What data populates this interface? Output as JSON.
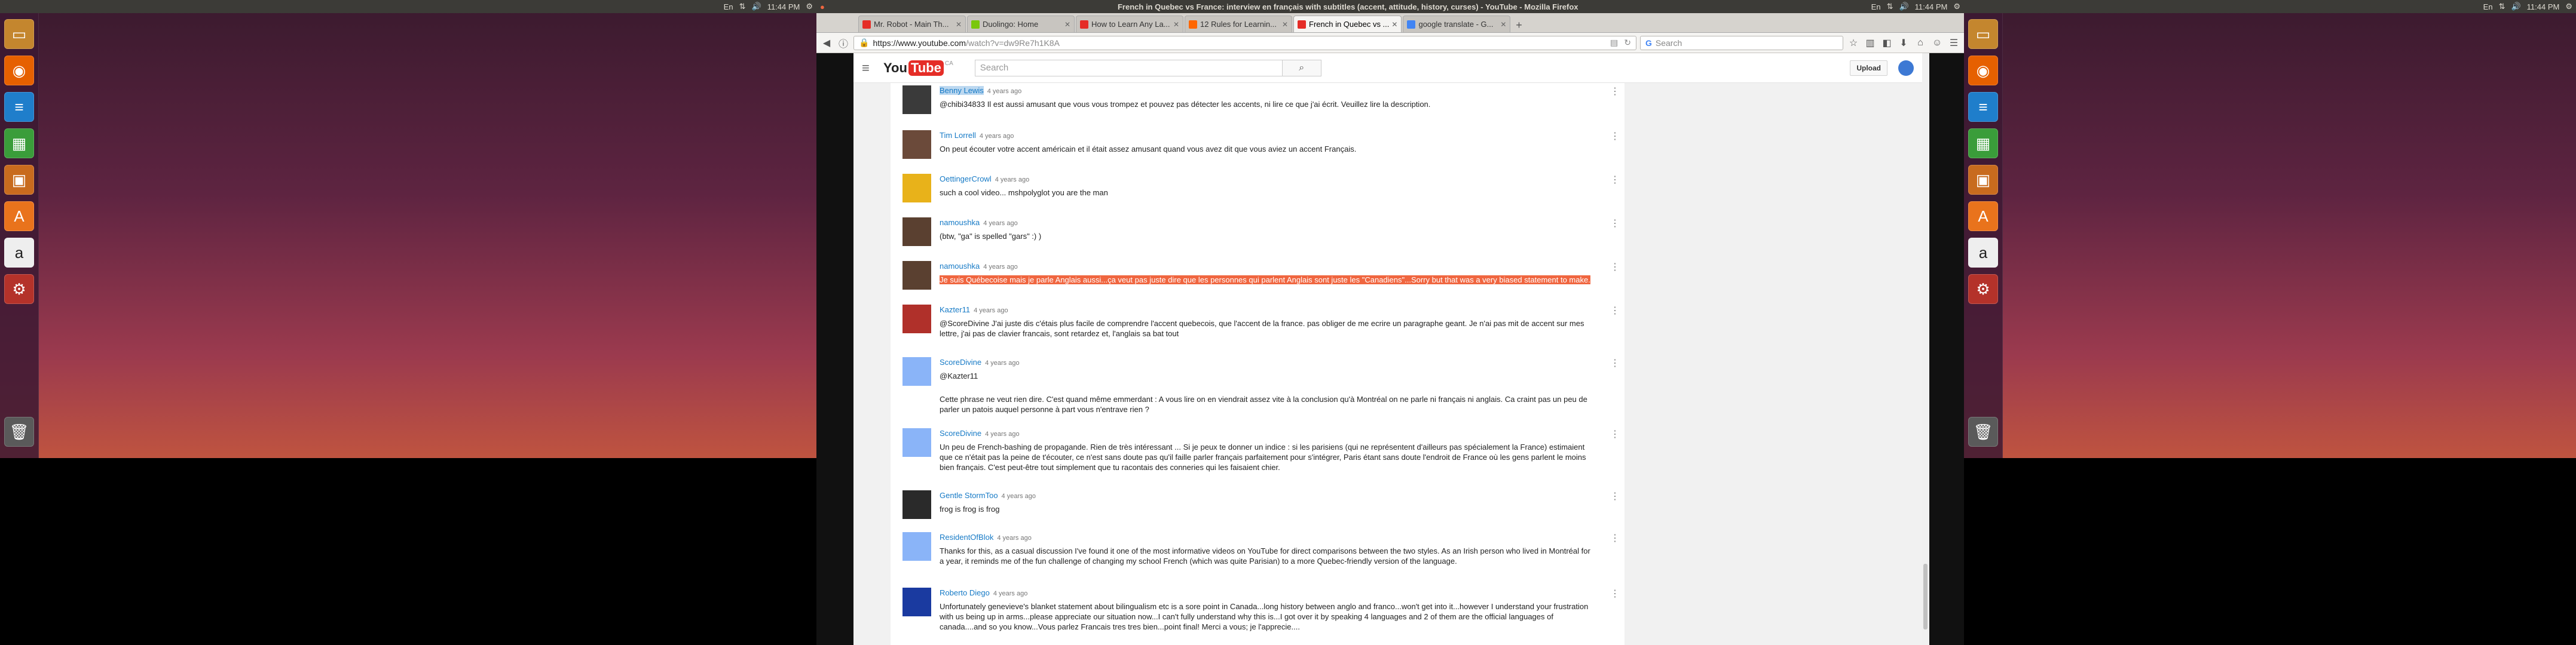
{
  "colors": {
    "accent": "#e52d27",
    "link": "#167ac6",
    "selection": "#f06640"
  },
  "left_screen": {
    "clock": "11:44 PM",
    "keyboard": "En",
    "launcher": [
      "files-icon",
      "firefox-icon",
      "writer-icon",
      "calc-icon",
      "impress-icon",
      "software-center-icon",
      "amazon-icon",
      "settings-icon"
    ],
    "trash": "trash-icon"
  },
  "right_screen": {
    "clock": "11:44 PM",
    "keyboard": "En",
    "launcher": [
      "files-icon",
      "firefox-icon",
      "writer-icon",
      "calc-icon",
      "impress-icon",
      "software-center-icon",
      "amazon-icon",
      "settings-icon"
    ]
  },
  "browser": {
    "window_title": "French in Quebec vs France: interview en français with subtitles (accent, attitude, history, curses) - YouTube - Mozilla Firefox",
    "clock": "11:44 PM",
    "keyboard": "En",
    "tabs": [
      {
        "label": "Mr. Robot - Main Th...",
        "color": "#e52d27",
        "active": false
      },
      {
        "label": "Duolingo: Home",
        "color": "#7ac70c",
        "active": false
      },
      {
        "label": "How to Learn Any La...",
        "color": "#e52d27",
        "active": false
      },
      {
        "label": "12 Rules for Learnin...",
        "color": "#ff6600",
        "active": false
      },
      {
        "label": "French in Quebec vs ...",
        "color": "#e52d27",
        "active": true
      },
      {
        "label": "google translate - G...",
        "color": "#4285f4",
        "active": false
      }
    ],
    "url_prefix": "https://www.youtube.com",
    "url_rest": "/watch?v=dw9Re7h1K8A",
    "search_placeholder": "Search",
    "yt": {
      "logo_text": "You",
      "logo_tube": "Tube",
      "logo_region": "CA",
      "search_placeholder": "Search",
      "upload_label": "Upload"
    },
    "comments": [
      {
        "author": "Benny Lewis",
        "time": "4 years ago",
        "text": "@chibi34833 Il est aussi amusant que vous vous trompez et pouvez pas détecter les accents, ni lire ce que j'ai écrit. Veuillez lire la description.",
        "av": "#3a3a3a",
        "hl_author": true
      },
      {
        "author": "Tim Lorrell",
        "time": "4 years ago",
        "text": "On peut écouter votre accent américain et il était assez amusant quand vous avez dit que vous aviez un accent Français.",
        "av": "#6b4a3a"
      },
      {
        "author": "OettingerCrowl",
        "time": "4 years ago",
        "text": "such a cool video... mshpolyglot you are the man",
        "av": "#e8b21a"
      },
      {
        "author": "namoushka",
        "time": "4 years ago",
        "text": "(btw, \"ga\" is spelled \"gars\" :) )",
        "av": "#5a4030"
      },
      {
        "author": "namoushka",
        "time": "4 years ago",
        "text": "Je suis Québecoise mais je parle Anglais aussi...ça veut pas juste dire que les personnes qui parlent Anglais sont juste les \"Canadiens\"...Sorry but that was a very biased statement to make.",
        "av": "#5a4030",
        "hl_text": true
      },
      {
        "author": "Kazter11",
        "time": "4 years ago",
        "text": "@ScoreDivine J'ai juste dis c'étais plus facile de comprendre l'accent quebecois, que l'accent de la france. pas obliger de me ecrire un paragraphe geant. Je n'ai pas mit de accent sur mes lettre, j'ai pas de clavier francais, sont retardez et, l'anglais sa bat tout",
        "av": "#b0302a"
      },
      {
        "author": "ScoreDivine",
        "time": "4 years ago",
        "text": "@Kazter11",
        "text2": "Cette phrase ne veut rien dire. C'est quand même emmerdant : A vous lire on en viendrait assez vite à la conclusion qu'à Montréal on ne parle ni français ni anglais. Ca craint pas un peu de parler un patois auquel personne à part vous n'entrave rien ?",
        "av": "#8ab4f8"
      },
      {
        "author": "ScoreDivine",
        "time": "4 years ago",
        "text": "Un peu de French-bashing de propagande. Rien de très intéressant ... Si je peux te donner un indice : si les parisiens (qui ne représentent d'ailleurs pas spécialement la France) estimaient que ce n'était pas la peine de t'écouter, ce n'est sans doute pas qu'il faille parler français parfaitement pour s'intégrer, Paris étant sans doute l'endroit de France où les gens parlent le moins bien français. C'est peut-être tout simplement que tu racontais des conneries qui les faisaient chier.",
        "av": "#8ab4f8"
      },
      {
        "author": "Gentle StormToo",
        "time": "4 years ago",
        "text": "frog is frog is frog",
        "av": "#2a2a2a"
      },
      {
        "author": "ResidentOfBlok",
        "time": "4 years ago",
        "text": "Thanks for this, as a casual discussion I've found it one of the most informative videos on YouTube for direct comparisons between the two styles. As an Irish person who lived in Montréal for a year, it reminds me of the fun challenge of changing my school French (which was quite Parisian) to a more Quebec-friendly version of the language.",
        "av": "#8ab4f8"
      },
      {
        "author": "Roberto Diego",
        "time": "4 years ago",
        "text": "Unfortunately genevieve's blanket statement about bilingualism etc is a sore point in Canada...long history between anglo and franco...won't get into it...however I understand your frustration with us being up in arms...please appreciate our situation now...I can't fully understand why this is...I got over it by speaking 4 languages and 2 of them are the official languages of canada....and so you know...Vous parlez Francais tres tres bien...point final! Merci a vous; je l'apprecie....",
        "av": "#1a3aa0"
      }
    ]
  }
}
